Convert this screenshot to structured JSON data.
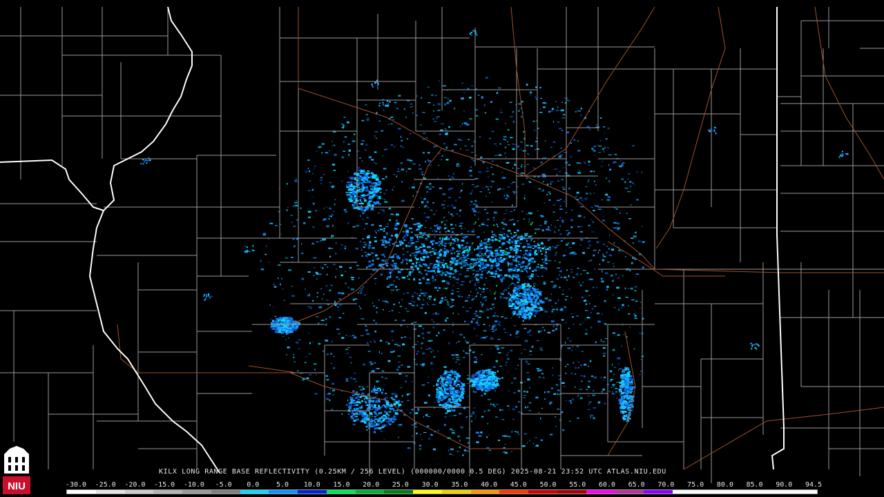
{
  "title": "KILX LONG RANGE BASE REFLECTIVITY (0.25KM / 256 LEVEL) (000000/0000 0.5 DEG) 2025-08-21 23:52 UTC  ATLAS.NIU.EDU",
  "logo_text": "NIU",
  "scale": {
    "labels": [
      "-30.0",
      "-25.0",
      "-20.0",
      "-15.0",
      "-10.0",
      "-5.0",
      "0.0",
      "5.0",
      "10.0",
      "15.0",
      "20.0",
      "25.0",
      "30.0",
      "35.0",
      "40.0",
      "45.0",
      "50.0",
      "55.0",
      "60.0",
      "65.0",
      "70.0",
      "75.0",
      "80.0",
      "85.0",
      "90.0",
      "94.5"
    ],
    "colors": [
      "#ffffff",
      "#e4e4e4",
      "#cccccc",
      "#b4b4b4",
      "#9a9a9a",
      "#7f7f7f",
      "#11d7ff",
      "#1192ff",
      "#0022d8",
      "#00e65a",
      "#00b032",
      "#008010",
      "#ffff00",
      "#f0d200",
      "#ff9400",
      "#ff3400",
      "#d00000",
      "#a80000",
      "#ff00f0",
      "#b8319e",
      "#8e00ff",
      "#fafafa",
      "#fafafa",
      "#fafafa",
      "#fafafa",
      "#fafafa"
    ]
  },
  "colors": {
    "county_lines": "#9a9a9a",
    "state_lines": "#ffffff",
    "highways": "#a0522d",
    "background": "#000000"
  }
}
